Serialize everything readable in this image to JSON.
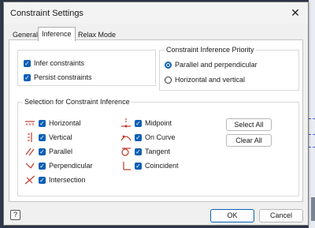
{
  "dialog": {
    "title": "Constraint Settings",
    "close_glyph": "✕"
  },
  "tabs": [
    {
      "label": "General",
      "active": false
    },
    {
      "label": "Inference",
      "active": true
    },
    {
      "label": "Relax Mode",
      "active": false
    }
  ],
  "inference_options": [
    {
      "label": "Infer constraints",
      "checked": true
    },
    {
      "label": "Persist constraints",
      "checked": true
    }
  ],
  "priority": {
    "title": "Constraint Inference Priority",
    "options": [
      {
        "label": "Parallel and perpendicular",
        "selected": true
      },
      {
        "label": "Horizontal and vertical",
        "selected": false
      }
    ]
  },
  "selection": {
    "title": "Selection for Constraint Inference",
    "left_column": [
      {
        "label": "Horizontal",
        "icon": "horizontal-constraint-icon",
        "checked": true
      },
      {
        "label": "Vertical",
        "icon": "vertical-constraint-icon",
        "checked": true
      },
      {
        "label": "Parallel",
        "icon": "parallel-constraint-icon",
        "checked": true
      },
      {
        "label": "Perpendicular",
        "icon": "perpendicular-constraint-icon",
        "checked": true
      },
      {
        "label": "Intersection",
        "icon": "intersection-constraint-icon",
        "checked": true
      }
    ],
    "right_column": [
      {
        "label": "Midpoint",
        "icon": "midpoint-constraint-icon",
        "checked": true
      },
      {
        "label": "On Curve",
        "icon": "on-curve-constraint-icon",
        "checked": true
      },
      {
        "label": "Tangent",
        "icon": "tangent-constraint-icon",
        "checked": true
      },
      {
        "label": "Coincident",
        "icon": "coincident-constraint-icon",
        "checked": true
      }
    ],
    "select_all_label": "Select All",
    "clear_all_label": "Clear All"
  },
  "footer": {
    "help_glyph": "?",
    "ok_label": "OK",
    "cancel_label": "Cancel"
  },
  "colors": {
    "accent": "#0d5fb5",
    "icon_red": "#c0392b"
  }
}
